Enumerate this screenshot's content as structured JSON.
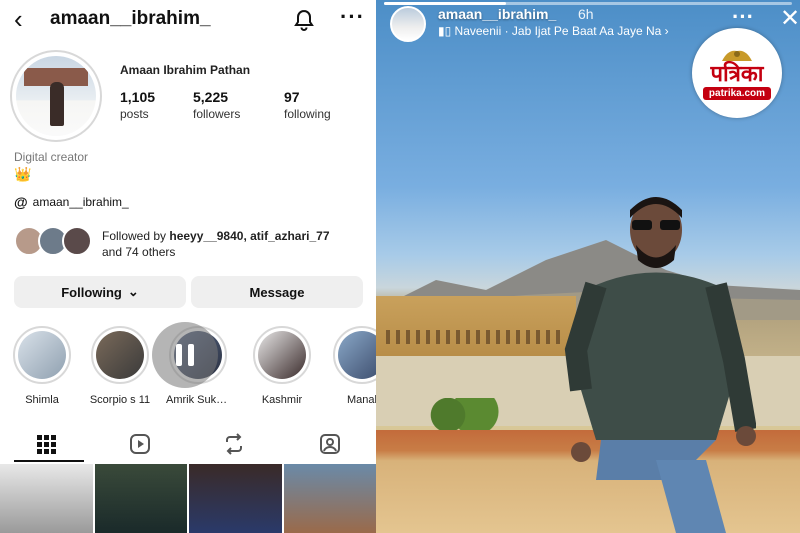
{
  "profile": {
    "username": "amaan__ibrahim_",
    "full_name": "Amaan Ibrahim Pathan",
    "stats": [
      {
        "value": "1,105",
        "label": "posts"
      },
      {
        "value": "5,225",
        "label": "followers"
      },
      {
        "value": "97",
        "label": "following"
      }
    ],
    "category": "Digital creator",
    "bio_emoji": "👑",
    "threads_handle": "amaan__ibrahim_",
    "followed_by": {
      "prefix": "Followed by",
      "users": "heeyy__9840, atif_azhari_77",
      "suffix": "and 74 others"
    },
    "buttons": {
      "following": "Following",
      "message": "Message"
    },
    "highlights": [
      "Shimla",
      "Scorpio s 11",
      "Amrik Sukh...",
      "Kashmir",
      "Manal"
    ]
  },
  "story": {
    "username": "amaan__ibrahim_",
    "time": "6h",
    "song": "Naveenii · Jab Ijat Pe Baat Aa Jaye Na",
    "logo_text": "पत्रिका",
    "logo_site": "patrika.com"
  },
  "icons": {
    "back": "back-arrow-icon",
    "bell": "bell-icon",
    "more": "more-icon",
    "grid": "grid-icon",
    "reels": "reels-icon",
    "reposts": "repost-icon",
    "tagged": "tagged-icon",
    "threads": "threads-icon",
    "music": "music-wave-icon",
    "close": "close-icon"
  },
  "colors": {
    "button_bg": "#efefef",
    "brand_red": "#c40010",
    "sky": "#79aee0"
  }
}
